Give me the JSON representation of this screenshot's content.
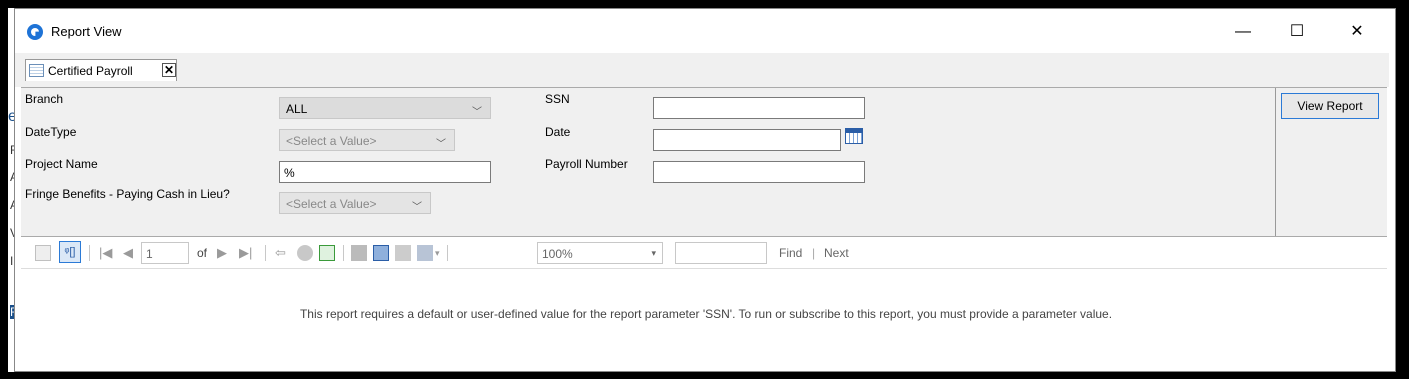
{
  "background_strip": {
    "letters": [
      "e",
      "F",
      "A",
      "A",
      "V",
      "I",
      "F"
    ]
  },
  "window": {
    "title": "Report View",
    "minimize": "—",
    "maximize": "☐",
    "close": "✕"
  },
  "tab": {
    "label": "Certified Payroll",
    "close": "✕"
  },
  "params": {
    "branch": {
      "label": "Branch",
      "value": "ALL"
    },
    "datetype": {
      "label": "DateType",
      "value": "<Select a Value>"
    },
    "project_name": {
      "label": "Project Name",
      "value": "%"
    },
    "fringe": {
      "label": "Fringe Benefits - Paying Cash in Lieu?",
      "value": "<Select a Value>"
    },
    "ssn": {
      "label": "SSN",
      "value": ""
    },
    "date": {
      "label": "Date",
      "value": ""
    },
    "payroll_number": {
      "label": "Payroll Number",
      "value": ""
    }
  },
  "view_report": "View Report",
  "toolbar": {
    "page": "1",
    "of": "of",
    "zoom": "100%",
    "find_value": "",
    "find": "Find",
    "sep": "|",
    "next": "Next"
  },
  "message": "This report requires a default or user-defined value for the report parameter 'SSN'. To run or subscribe to this report, you must provide a parameter value."
}
